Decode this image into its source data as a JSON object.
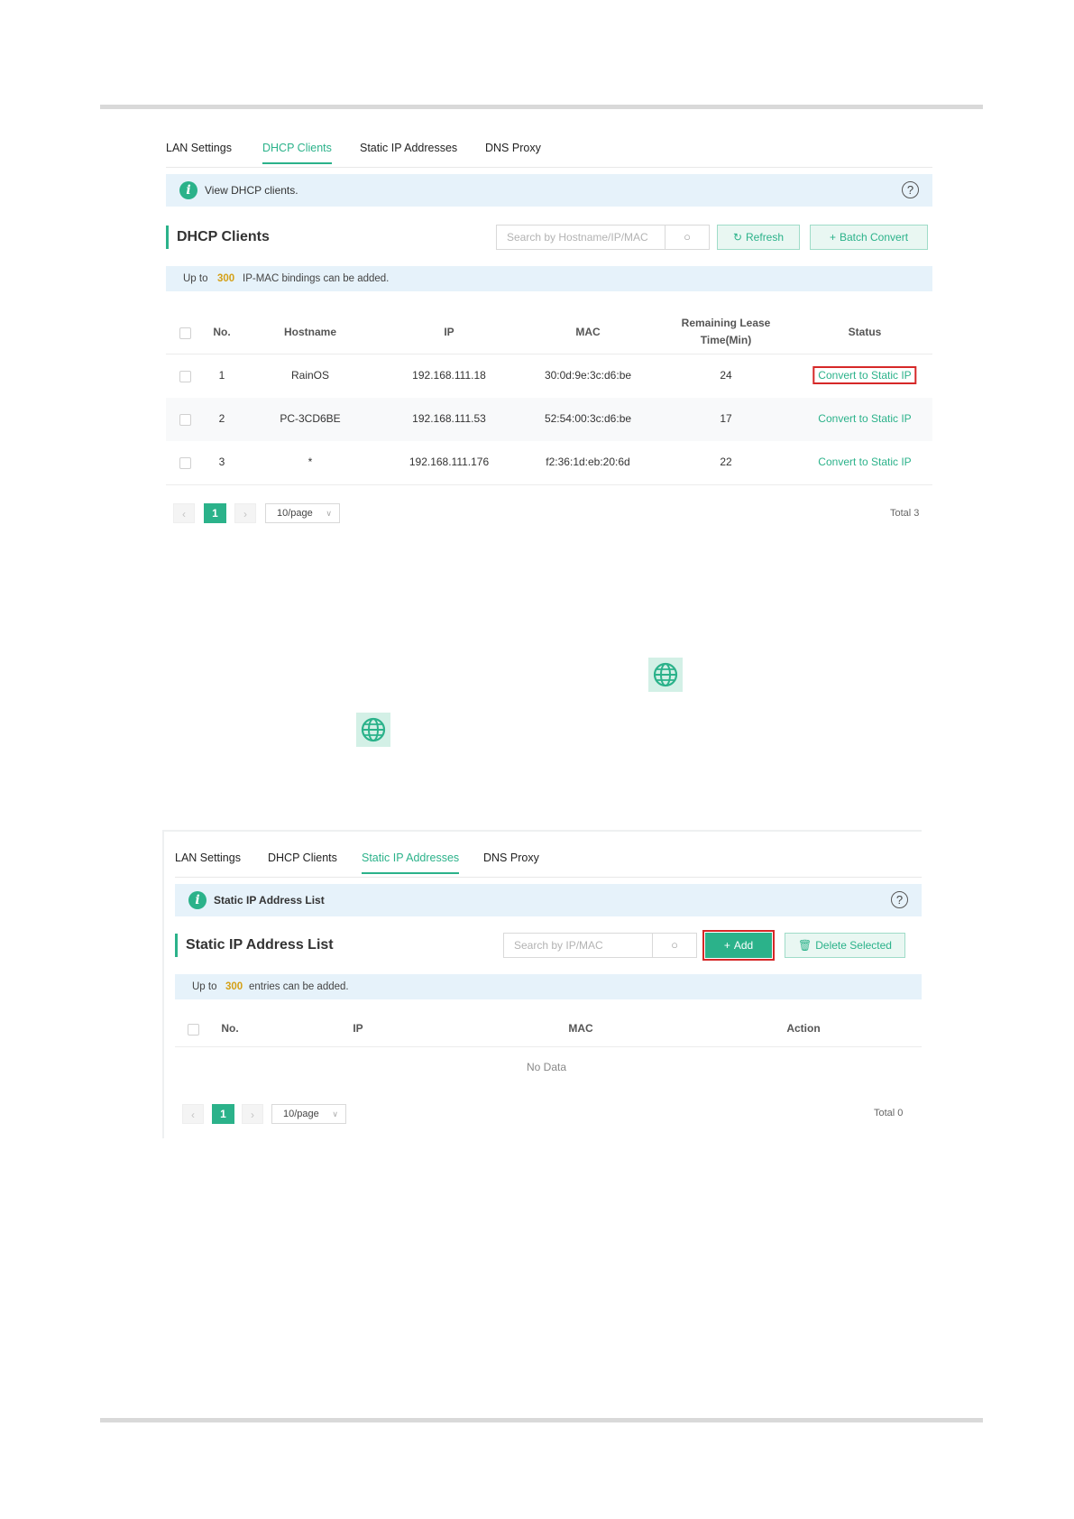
{
  "dhcp_panel": {
    "tabs": [
      "LAN Settings",
      "DHCP Clients",
      "Static IP Addresses",
      "DNS Proxy"
    ],
    "active_tab": "DHCP Clients",
    "info_text": "View DHCP clients.",
    "section_title": "DHCP Clients",
    "search_placeholder": "Search by Hostname/IP/MAC",
    "refresh_label": "Refresh",
    "batch_convert_label": "Batch Convert",
    "note_prefix": "Up to",
    "note_number": "300",
    "note_suffix": "IP-MAC bindings can be added.",
    "columns": {
      "no": "No.",
      "hostname": "Hostname",
      "ip": "IP",
      "mac": "MAC",
      "lease_line1": "Remaining Lease",
      "lease_line2": "Time(Min)",
      "status": "Status"
    },
    "rows": [
      {
        "no": "1",
        "hostname": "RainOS",
        "ip": "192.168.111.18",
        "mac": "30:0d:9e:3c:d6:be",
        "lease": "24",
        "status": "Convert to Static IP"
      },
      {
        "no": "2",
        "hostname": "PC-3CD6BE",
        "ip": "192.168.111.53",
        "mac": "52:54:00:3c:d6:be",
        "lease": "17",
        "status": "Convert to Static IP"
      },
      {
        "no": "3",
        "hostname": "*",
        "ip": "192.168.111.176",
        "mac": "f2:36:1d:eb:20:6d",
        "lease": "22",
        "status": "Convert to Static IP"
      }
    ],
    "pagination": {
      "current": "1",
      "page_size": "10/page",
      "total": "Total 3"
    }
  },
  "static_panel": {
    "tabs": [
      "LAN Settings",
      "DHCP Clients",
      "Static IP Addresses",
      "DNS Proxy"
    ],
    "active_tab": "Static IP Addresses",
    "info_text": "Static IP Address List",
    "section_title": "Static IP Address List",
    "search_placeholder": "Search by IP/MAC",
    "add_label": "Add",
    "delete_label": "Delete Selected",
    "note_prefix": "Up to",
    "note_number": "300",
    "note_suffix": "entries can be added.",
    "columns": {
      "no": "No.",
      "ip": "IP",
      "mac": "MAC",
      "action": "Action"
    },
    "empty_text": "No Data",
    "pagination": {
      "current": "1",
      "page_size": "10/page",
      "total": "Total 0"
    }
  },
  "icons": {
    "globe": "globe-icon",
    "info": "info-icon",
    "help": "help-icon",
    "search": "search-icon",
    "refresh": "refresh-icon",
    "plus": "plus-icon",
    "delete": "trash-icon"
  },
  "colors": {
    "accent": "#2bb28a",
    "info_bg": "#e6f2fa",
    "highlight": "#d62828",
    "note_number": "#d4a017"
  }
}
